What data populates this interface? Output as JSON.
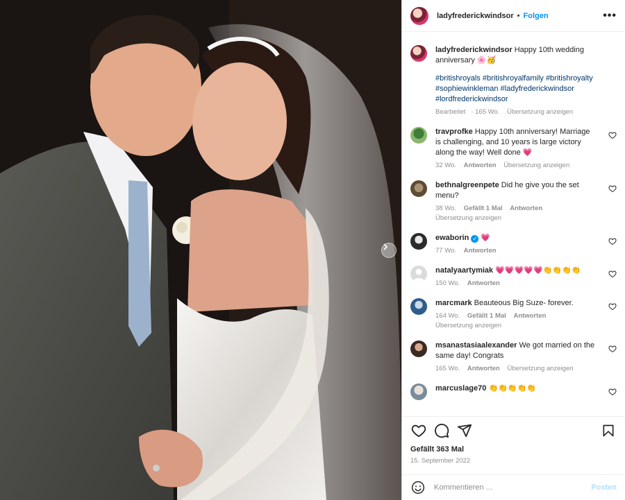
{
  "header": {
    "username": "ladyfrederickwindsor",
    "dot": "•",
    "follow_label": "Folgen",
    "more_label": "•••"
  },
  "caption": {
    "username": "ladyfrederickwindsor",
    "text": "Happy 10th wedding anniversary",
    "emoji": "🌸🥳",
    "hashtags": "#britishroyals #britishroyalfamily #britishroyalty #sophiewinkleman #ladyfrederickwindsor #lordfrederickwindsor",
    "edited": "Bearbeitet",
    "age": "165 Wo.",
    "translate": "Übersetzung anzeigen"
  },
  "comments": [
    {
      "username": "travprofke",
      "text": "Happy 10th anniversary! Marriage is challenging, and 10 years is large victory along the way! Well done",
      "emoji": "💗",
      "age": "32 Wo.",
      "likes": "",
      "reply": "Antworten",
      "translate": "Übersetzung anzeigen"
    },
    {
      "username": "bethnalgreenpete",
      "text": "Did he give you the set menu?",
      "emoji": "",
      "age": "38 Wo.",
      "likes": "Gefällt 1 Mal",
      "reply": "Antworten",
      "translate": "Übersetzung anzeigen"
    },
    {
      "username": "ewaborin",
      "text": "",
      "emoji": "💗",
      "age": "77 Wo.",
      "likes": "",
      "reply": "Antworten",
      "translate": ""
    },
    {
      "username": "natalyaartymiak",
      "text": "",
      "emoji": "💗💗💗💗💗👏👏👏👏",
      "age": "150 Wo.",
      "likes": "",
      "reply": "Antworten",
      "translate": ""
    },
    {
      "username": "marcmark",
      "text": "Beauteous Big Suze- forever.",
      "emoji": "",
      "age": "164 Wo.",
      "likes": "Gefällt 1 Mal",
      "reply": "Antworten",
      "translate": "Übersetzung anzeigen"
    },
    {
      "username": "msanastasiaalexander",
      "text": "We got married on the same day! Congrats",
      "emoji": "",
      "age": "165 Wo.",
      "likes": "",
      "reply": "Antworten",
      "translate": "Übersetzung anzeigen"
    },
    {
      "username": "marcuslage70",
      "text": "",
      "emoji": "👏👏👏👏👏",
      "age": "",
      "likes": "",
      "reply": "",
      "translate": ""
    }
  ],
  "footer": {
    "likes": "Gefällt 363 Mal",
    "date": "15. September 2022",
    "comment_placeholder": "Kommentieren ...",
    "post_label": "Posten"
  },
  "icons": {
    "heart": "heart-icon",
    "comment": "comment-icon",
    "share": "send-icon",
    "bookmark": "bookmark-icon",
    "emoji": "emoji-icon",
    "next": "chevron-right-icon"
  },
  "colors": {
    "link": "#00376b",
    "accent": "#0095f6",
    "muted": "#8e8e8e",
    "post_disabled": "#b2dffc"
  }
}
